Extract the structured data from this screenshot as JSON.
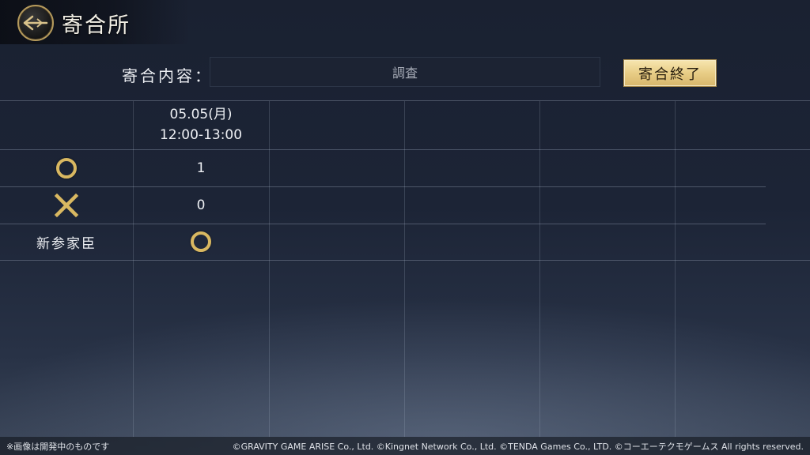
{
  "header": {
    "title": "寄合所",
    "back_icon": "arrow-back-icon"
  },
  "meeting": {
    "content_label": "寄合内容：",
    "content_value": "調査",
    "end_button_label": "寄合終了"
  },
  "schedule": {
    "columns": [
      {
        "date": "05.05(月)",
        "time": "12:00-13:00"
      }
    ],
    "rows": [
      {
        "label_icon": "circle-icon",
        "value": "1"
      },
      {
        "label_icon": "cross-icon",
        "value": "0"
      },
      {
        "label": "新参家臣",
        "value_icon": "circle-icon"
      }
    ]
  },
  "colors": {
    "accent_gold": "#d9b861",
    "button_gold": "#e8cd86",
    "background": "#1c2436"
  },
  "footer": {
    "note": "※画像は開発中のものです",
    "copyright": "©GRAVITY GAME ARISE Co., Ltd. ©Kingnet Network Co., Ltd. ©TENDA Games Co., LTD. ©コーエーテクモゲームス All rights reserved."
  }
}
